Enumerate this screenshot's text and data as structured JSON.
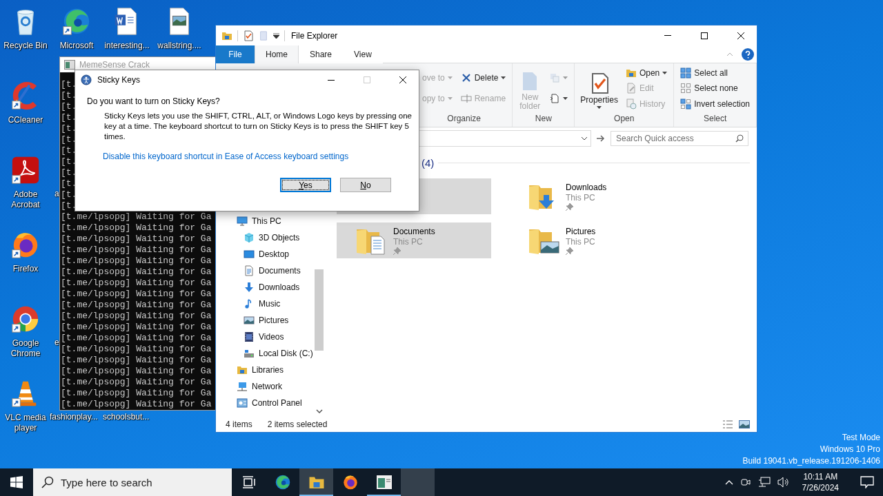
{
  "desktop_icons": [
    {
      "label": "Recycle Bin",
      "kind": "recycle",
      "shortcut": false
    },
    {
      "label": "Microsoft",
      "kind": "edge",
      "shortcut": true
    },
    {
      "label": "interesting...",
      "kind": "word",
      "shortcut": false
    },
    {
      "label": "wallstring....",
      "kind": "image",
      "shortcut": false
    },
    {
      "label": "CCleaner",
      "kind": "ccleaner",
      "shortcut": true
    },
    {
      "label": "Adobe Acrobat",
      "kind": "acrobat",
      "shortcut": true
    },
    {
      "label": "Firefox",
      "kind": "firefox",
      "shortcut": true
    },
    {
      "label": "Google Chrome",
      "kind": "chrome",
      "shortcut": true
    },
    {
      "label": "VLC media player",
      "kind": "vlc",
      "shortcut": true
    },
    {
      "label": "a",
      "kind": "hidden"
    },
    {
      "label": "e",
      "kind": "hidden"
    },
    {
      "label": "fashionplay...",
      "kind": "hidden"
    },
    {
      "label": "schoolsbut...",
      "kind": "hidden"
    }
  ],
  "console": {
    "title": "MemeSense Crack",
    "lines": [
      "[t.",
      "[t.",
      "[t.",
      "[t.",
      "[t.",
      "[t.",
      "[t.",
      "[t.",
      "[t.",
      "[t.",
      "[t.",
      "[t.",
      "[t.me/lpsopg] Waiting for Ga",
      "[t.me/lpsopg] Waiting for Ga",
      "[t.me/lpsopg] Waiting for Ga",
      "[t.me/lpsopg] Waiting for Ga",
      "[t.me/lpsopg] Waiting for Ga",
      "[t.me/lpsopg] Waiting for Ga",
      "[t.me/lpsopg] Waiting for Ga",
      "[t.me/lpsopg] Waiting for Ga",
      "[t.me/lpsopg] Waiting for Ga",
      "[t.me/lpsopg] Waiting for Ga",
      "[t.me/lpsopg] Waiting for Ga",
      "[t.me/lpsopg] Waiting for Ga",
      "[t.me/lpsopg] Waiting for Ga",
      "[t.me/lpsopg] Waiting for Ga",
      "[t.me/lpsopg] Waiting for Ga",
      "[t.me/lpsopg] Waiting for Ga",
      "[t.me/lpsopg] Waiting for Ga",
      "[t.me/lpsopg] Waiting for Ga"
    ]
  },
  "explorer": {
    "title": "File Explorer",
    "tabs": [
      {
        "label": "File",
        "kind": "file",
        "selected": false
      },
      {
        "label": "Home",
        "kind": "tab",
        "selected": true
      },
      {
        "label": "Share",
        "kind": "tab",
        "selected": false
      },
      {
        "label": "View",
        "kind": "tab",
        "selected": false
      }
    ],
    "groups": [
      {
        "label": "Organize",
        "columns": [
          [
            {
              "kind": "small",
              "label": "ove to",
              "disabled": true,
              "dropdown": true
            },
            {
              "kind": "small",
              "label": "opy to",
              "disabled": true,
              "dropdown": true
            }
          ],
          [
            {
              "kind": "small",
              "label": "Delete",
              "disabled": false,
              "dropdown": true
            },
            {
              "kind": "small",
              "label": "Rename",
              "disabled": true,
              "dropdown": false
            }
          ]
        ]
      },
      {
        "label": "New",
        "columns": [
          [
            {
              "kind": "large",
              "label": "New folder",
              "disabled": true,
              "dropdown": false
            }
          ],
          [
            {
              "kind": "icon",
              "disabled": true,
              "dropdown": true
            },
            {
              "kind": "icon",
              "disabled": false,
              "dropdown": true
            }
          ]
        ]
      },
      {
        "label": "Open",
        "columns": [
          [
            {
              "kind": "large",
              "label": "Properties",
              "disabled": false,
              "dropdown": true
            }
          ],
          [
            {
              "kind": "small",
              "label": "Open",
              "disabled": false,
              "dropdown": true
            },
            {
              "kind": "small",
              "label": "Edit",
              "disabled": true,
              "dropdown": false
            },
            {
              "kind": "small",
              "label": "History",
              "disabled": true,
              "dropdown": false
            }
          ]
        ]
      },
      {
        "label": "Select",
        "columns": [
          [
            {
              "kind": "small",
              "label": "Select all",
              "disabled": false,
              "dropdown": false
            },
            {
              "kind": "small",
              "label": "Select none",
              "disabled": false,
              "dropdown": false
            },
            {
              "kind": "small",
              "label": "Invert selection",
              "disabled": false,
              "dropdown": false
            }
          ]
        ]
      }
    ],
    "search": {
      "placeholder": "Search Quick access"
    },
    "nav": [
      {
        "label": "This PC",
        "children": [
          {
            "label": "3D Objects"
          },
          {
            "label": "Desktop"
          },
          {
            "label": "Documents"
          },
          {
            "label": "Downloads"
          },
          {
            "label": "Music"
          },
          {
            "label": "Pictures"
          },
          {
            "label": "Videos"
          },
          {
            "label": "Local Disk (C:)"
          }
        ]
      },
      {
        "label": "Libraries"
      },
      {
        "label": "Network"
      },
      {
        "label": "Control Panel"
      }
    ],
    "section_header": "(4)",
    "folders": [
      {
        "selected": true
      },
      {
        "name": "Downloads",
        "location": "This PC",
        "selected": false
      },
      {
        "name": "Documents",
        "location": "This PC",
        "selected": true
      },
      {
        "name": "Pictures",
        "location": "This PC",
        "selected": false
      }
    ],
    "status": {
      "count": "4 items",
      "selection": "2 items selected"
    }
  },
  "dialog": {
    "title": "Sticky Keys",
    "question": "Do you want to turn on Sticky Keys?",
    "body": "Sticky Keys lets you use the SHIFT, CTRL, ALT, or Windows Logo keys by pressing one key at a time. The keyboard shortcut to turn on Sticky Keys is to press the SHIFT key 5 times.",
    "link": "Disable this keyboard shortcut in Ease of Access keyboard settings",
    "buttons": [
      {
        "label": "Yes",
        "focused": true
      },
      {
        "label": "No",
        "focused": false
      }
    ]
  },
  "system_info": [
    "Test Mode",
    "Windows 10 Pro",
    "Build 19041.vb_release.191206-1406"
  ],
  "taskbar": {
    "search_placeholder": "Type here to search",
    "apps": [
      {
        "kind": "taskview",
        "active": false,
        "running": false
      },
      {
        "kind": "edge",
        "active": false,
        "running": false
      },
      {
        "kind": "explorer",
        "active": true,
        "running": true
      },
      {
        "kind": "firefox",
        "active": false,
        "running": false
      },
      {
        "kind": "console",
        "active": false,
        "running": true
      },
      {
        "kind": "blank",
        "active": true,
        "running": false
      }
    ],
    "time": "10:11 AM",
    "date": "7/26/2024"
  }
}
